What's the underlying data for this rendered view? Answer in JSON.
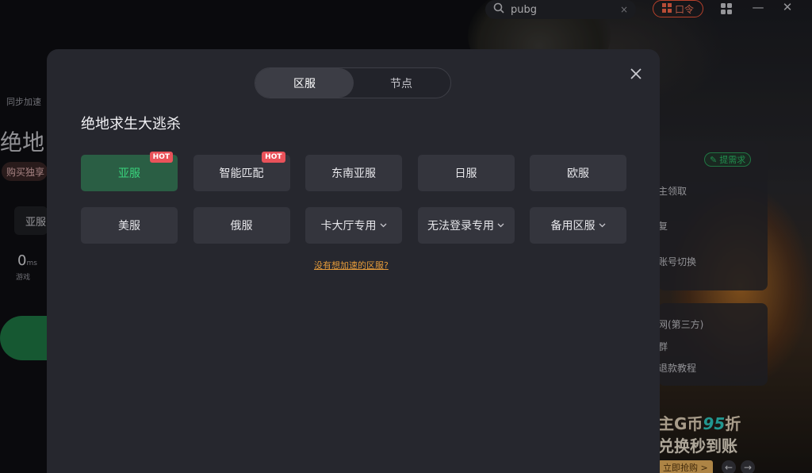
{
  "topbar": {
    "search_query": "pubg",
    "kou_label": "口令"
  },
  "background": {
    "sync_label": "同步加速",
    "game_title_partial": "绝地",
    "buy_label": "购买独享",
    "region_label": "亚服",
    "ping_value": "0",
    "ping_unit": "ms",
    "game_label": "游戏",
    "right_tag": "提需求",
    "right_items": [
      "主领取",
      "复",
      "账号切换"
    ],
    "right2_items": [
      "网(第三方)",
      "群",
      "退款教程"
    ],
    "promo_line1_prefix": "主G币",
    "promo_line1_num": "95",
    "promo_line1_suffix": "折",
    "promo_line2": "兑换秒到账",
    "promo_button": "立即抢购 >"
  },
  "modal": {
    "tabs": [
      {
        "label": "区服",
        "active": true
      },
      {
        "label": "节点",
        "active": false
      }
    ],
    "game_title": "绝地求生大逃杀",
    "hot_badge": "HOT",
    "servers_row1": [
      {
        "label": "亚服",
        "selected": true,
        "hot": true
      },
      {
        "label": "智能匹配",
        "selected": false,
        "hot": true
      },
      {
        "label": "东南亚服",
        "selected": false,
        "hot": false
      },
      {
        "label": "日服",
        "selected": false,
        "hot": false
      },
      {
        "label": "欧服",
        "selected": false,
        "hot": false
      }
    ],
    "servers_row2": [
      {
        "label": "美服",
        "dropdown": false
      },
      {
        "label": "俄服",
        "dropdown": false
      },
      {
        "label": "卡大厅专用",
        "dropdown": true
      },
      {
        "label": "无法登录专用",
        "dropdown": true
      },
      {
        "label": "备用区服",
        "dropdown": true
      }
    ],
    "no_region_link": "没有想加速的区服?"
  },
  "colors": {
    "modal_bg": "#26272e",
    "button_bg": "#34353d",
    "selected_bg": "#2a5e44",
    "selected_text": "#39d27c",
    "hot_badge": "#e9525a",
    "link": "#e39a3a"
  }
}
